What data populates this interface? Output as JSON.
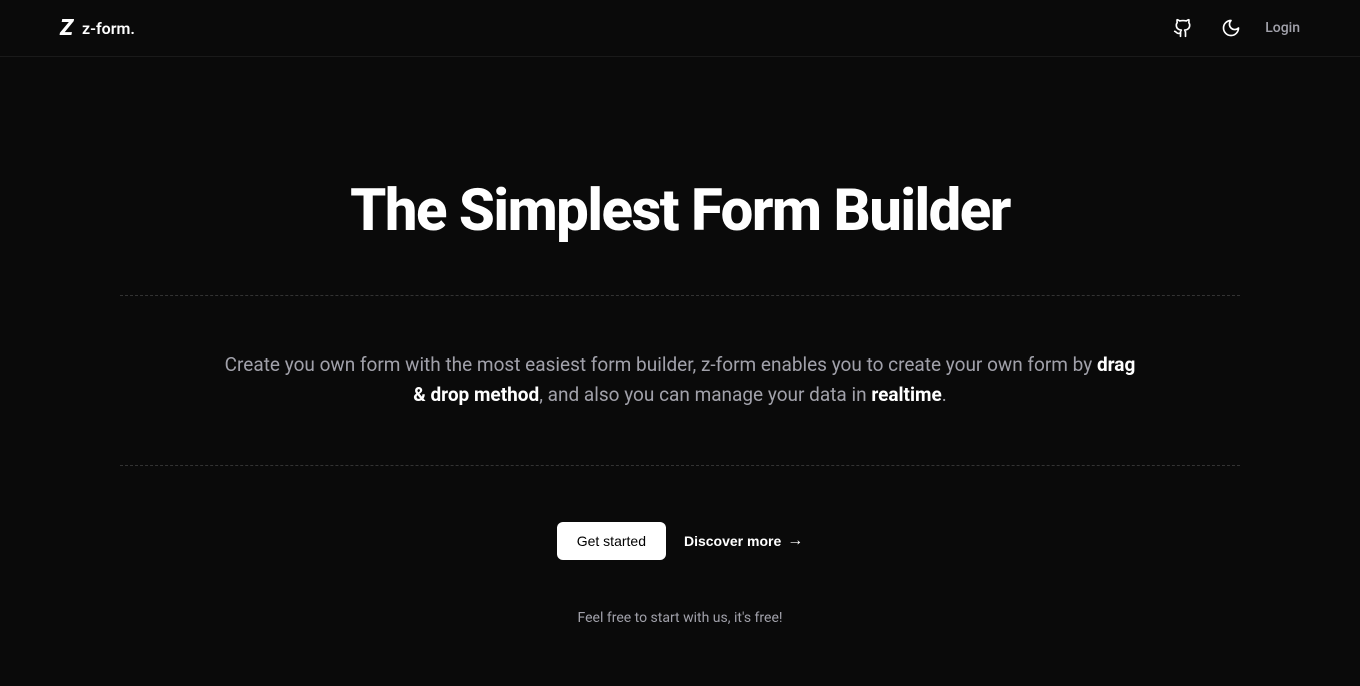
{
  "header": {
    "brand": "z-form.",
    "login": "Login"
  },
  "hero": {
    "title": "The Simplest Form Builder",
    "desc_part1": "Create you own form with the most easiest form builder, z-form enables you to create your own form by ",
    "desc_bold1": "drag & drop method",
    "desc_part2": ", and also you can manage your data in ",
    "desc_bold2": "realtime",
    "desc_part3": ".",
    "cta_primary": "Get started",
    "cta_secondary": "Discover more",
    "tagline": "Feel free to start with us, it's free!"
  }
}
